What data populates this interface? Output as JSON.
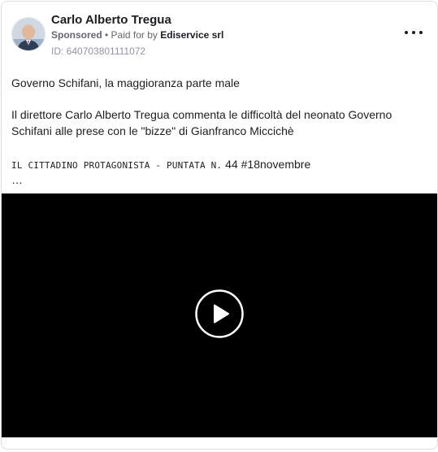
{
  "post": {
    "author": "Carlo Alberto Tregua",
    "sponsored_label": "Sponsored",
    "separator": " • ",
    "paid_for_prefix": "Paid for by ",
    "payer": "Ediservice srl",
    "ad_id": "ID: 640703801111072",
    "headline": "Governo Schifani, la maggioranza parte male",
    "body": "Il direttore Carlo Alberto Tregua commenta le difficoltà del neonato Governo Schifani alle prese con le \"bizze\" di Gianfranco Miccichè",
    "series_caps": "IL CITTADINO PROTAGONISTA - PUNTATA N.",
    "series_tail": " 44 #18novembre",
    "truncation": "…"
  },
  "icons": {
    "more": "more-horizontal-icon",
    "play": "play-icon"
  },
  "colors": {
    "video_bg": "#000000",
    "text": "#1c1e21",
    "muted": "#65676b"
  }
}
